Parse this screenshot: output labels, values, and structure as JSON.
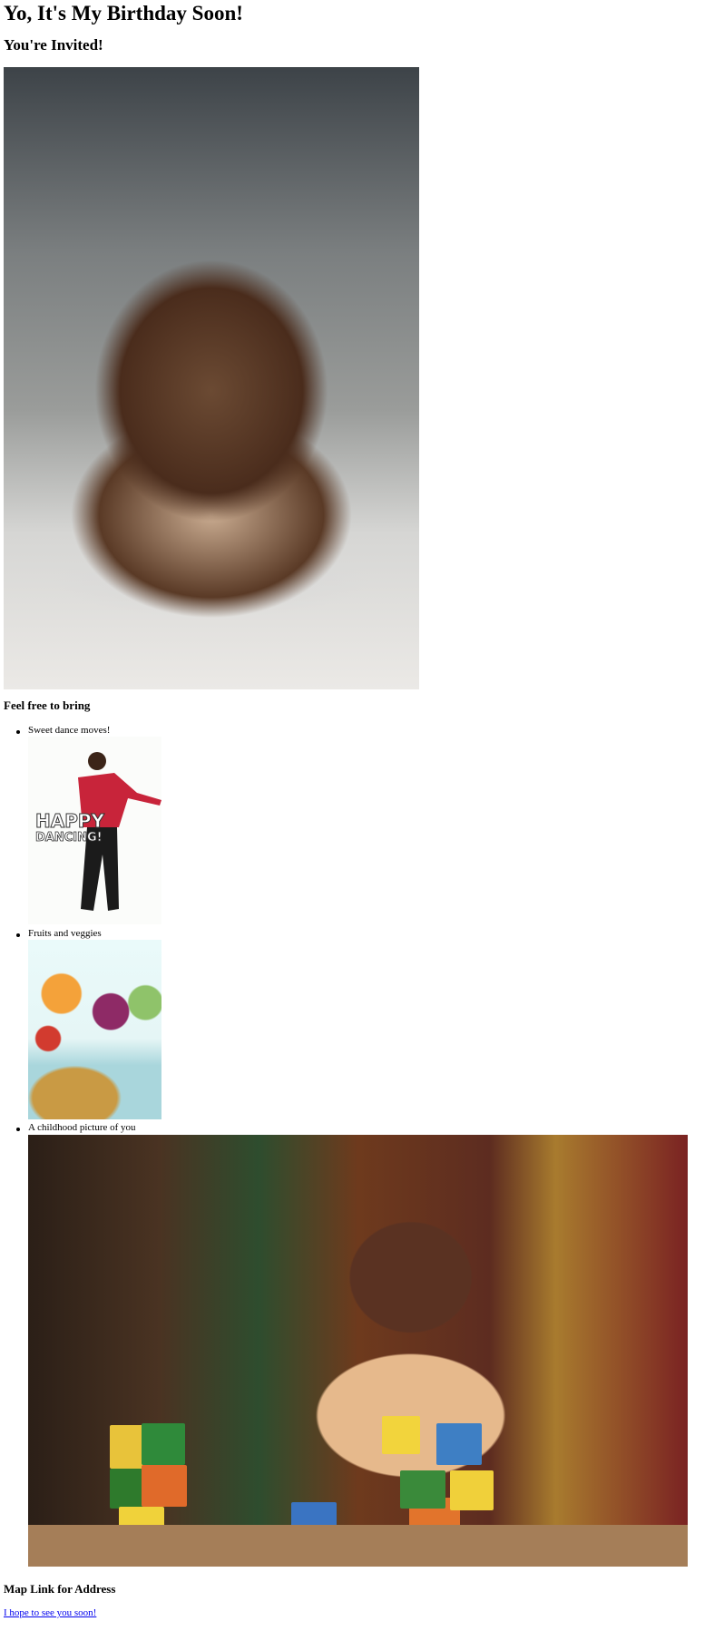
{
  "title": "Yo, It's My Birthday Soon!",
  "subtitle": "You're Invited!",
  "images": {
    "cake": "chocolate drip birthday cake",
    "dance": "HAPPY DANCING!",
    "fruits": "cartoon fruits and veggies",
    "child": "smiling toddler with toy blocks"
  },
  "bring": {
    "heading": "Feel free to bring",
    "items": [
      {
        "label": "Sweet dance moves!"
      },
      {
        "label": "Fruits and veggies"
      },
      {
        "label": "A childhood picture of you"
      }
    ]
  },
  "map": {
    "heading": "Map Link for Address",
    "link_text": "I hope to see you soon!"
  },
  "colors": {
    "link": "#0000ee"
  }
}
